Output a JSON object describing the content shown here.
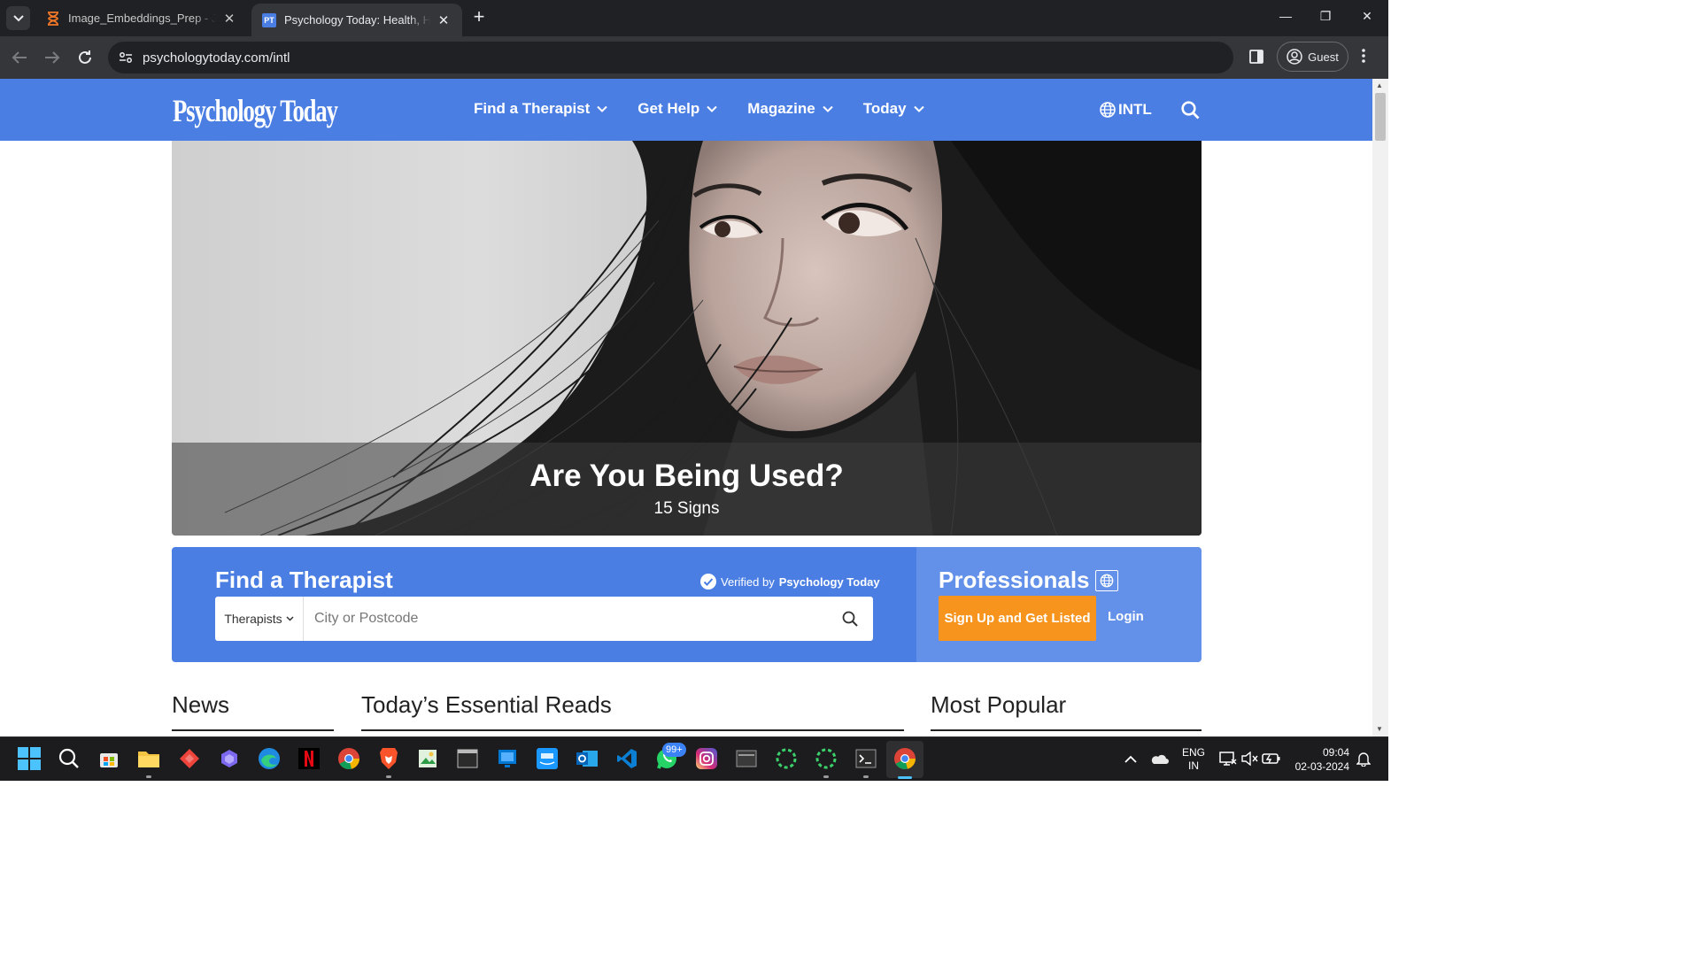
{
  "browser": {
    "tabs": [
      {
        "title": "Image_Embeddings_Prep - Jupyter",
        "active": false
      },
      {
        "title": "Psychology Today: Health, Help",
        "active": true
      }
    ],
    "url": "psychologytoday.com/intl",
    "profile_label": "Guest",
    "favicon_pt": "PT"
  },
  "site": {
    "logo_text": "Psychology Today",
    "nav": [
      "Find a Therapist",
      "Get Help",
      "Magazine",
      "Today"
    ],
    "region_label": "INTL"
  },
  "hero": {
    "title": "Are You Being Used?",
    "subtitle": "15 Signs"
  },
  "finder": {
    "title": "Find a Therapist",
    "verified_prefix": "Verified by",
    "verified_brand": "Psychology Today",
    "type_select": "Therapists",
    "city_placeholder": "City or Postcode"
  },
  "professionals": {
    "title": "Professionals",
    "signup_label": "Sign Up and Get Listed",
    "login_label": "Login"
  },
  "sections": [
    "News",
    "Today’s Essential Reads",
    "Most Popular"
  ],
  "taskbar": {
    "whatsapp_badge": "99+",
    "language": "ENG",
    "region": "IN",
    "time": "09:04",
    "date": "02-03-2024"
  },
  "colors": {
    "brand_blue": "#4a7ee3",
    "pro_blue": "#6390e8",
    "signup_orange": "#f7941d"
  }
}
